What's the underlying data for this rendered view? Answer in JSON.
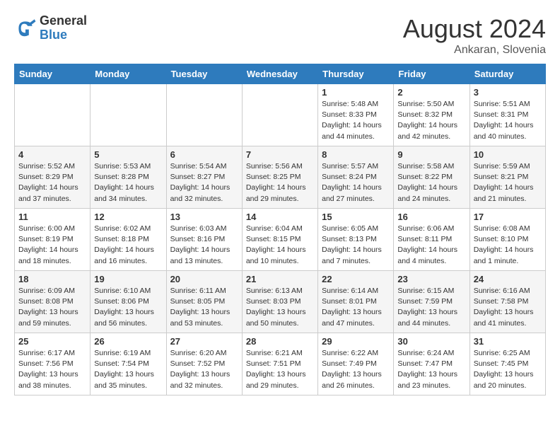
{
  "logo": {
    "general": "General",
    "blue": "Blue"
  },
  "header": {
    "month": "August 2024",
    "location": "Ankaran, Slovenia"
  },
  "days_of_week": [
    "Sunday",
    "Monday",
    "Tuesday",
    "Wednesday",
    "Thursday",
    "Friday",
    "Saturday"
  ],
  "weeks": [
    [
      {
        "day": "",
        "info": ""
      },
      {
        "day": "",
        "info": ""
      },
      {
        "day": "",
        "info": ""
      },
      {
        "day": "",
        "info": ""
      },
      {
        "day": "1",
        "info": "Sunrise: 5:48 AM\nSunset: 8:33 PM\nDaylight: 14 hours and 44 minutes."
      },
      {
        "day": "2",
        "info": "Sunrise: 5:50 AM\nSunset: 8:32 PM\nDaylight: 14 hours and 42 minutes."
      },
      {
        "day": "3",
        "info": "Sunrise: 5:51 AM\nSunset: 8:31 PM\nDaylight: 14 hours and 40 minutes."
      }
    ],
    [
      {
        "day": "4",
        "info": "Sunrise: 5:52 AM\nSunset: 8:29 PM\nDaylight: 14 hours and 37 minutes."
      },
      {
        "day": "5",
        "info": "Sunrise: 5:53 AM\nSunset: 8:28 PM\nDaylight: 14 hours and 34 minutes."
      },
      {
        "day": "6",
        "info": "Sunrise: 5:54 AM\nSunset: 8:27 PM\nDaylight: 14 hours and 32 minutes."
      },
      {
        "day": "7",
        "info": "Sunrise: 5:56 AM\nSunset: 8:25 PM\nDaylight: 14 hours and 29 minutes."
      },
      {
        "day": "8",
        "info": "Sunrise: 5:57 AM\nSunset: 8:24 PM\nDaylight: 14 hours and 27 minutes."
      },
      {
        "day": "9",
        "info": "Sunrise: 5:58 AM\nSunset: 8:22 PM\nDaylight: 14 hours and 24 minutes."
      },
      {
        "day": "10",
        "info": "Sunrise: 5:59 AM\nSunset: 8:21 PM\nDaylight: 14 hours and 21 minutes."
      }
    ],
    [
      {
        "day": "11",
        "info": "Sunrise: 6:00 AM\nSunset: 8:19 PM\nDaylight: 14 hours and 18 minutes."
      },
      {
        "day": "12",
        "info": "Sunrise: 6:02 AM\nSunset: 8:18 PM\nDaylight: 14 hours and 16 minutes."
      },
      {
        "day": "13",
        "info": "Sunrise: 6:03 AM\nSunset: 8:16 PM\nDaylight: 14 hours and 13 minutes."
      },
      {
        "day": "14",
        "info": "Sunrise: 6:04 AM\nSunset: 8:15 PM\nDaylight: 14 hours and 10 minutes."
      },
      {
        "day": "15",
        "info": "Sunrise: 6:05 AM\nSunset: 8:13 PM\nDaylight: 14 hours and 7 minutes."
      },
      {
        "day": "16",
        "info": "Sunrise: 6:06 AM\nSunset: 8:11 PM\nDaylight: 14 hours and 4 minutes."
      },
      {
        "day": "17",
        "info": "Sunrise: 6:08 AM\nSunset: 8:10 PM\nDaylight: 14 hours and 1 minute."
      }
    ],
    [
      {
        "day": "18",
        "info": "Sunrise: 6:09 AM\nSunset: 8:08 PM\nDaylight: 13 hours and 59 minutes."
      },
      {
        "day": "19",
        "info": "Sunrise: 6:10 AM\nSunset: 8:06 PM\nDaylight: 13 hours and 56 minutes."
      },
      {
        "day": "20",
        "info": "Sunrise: 6:11 AM\nSunset: 8:05 PM\nDaylight: 13 hours and 53 minutes."
      },
      {
        "day": "21",
        "info": "Sunrise: 6:13 AM\nSunset: 8:03 PM\nDaylight: 13 hours and 50 minutes."
      },
      {
        "day": "22",
        "info": "Sunrise: 6:14 AM\nSunset: 8:01 PM\nDaylight: 13 hours and 47 minutes."
      },
      {
        "day": "23",
        "info": "Sunrise: 6:15 AM\nSunset: 7:59 PM\nDaylight: 13 hours and 44 minutes."
      },
      {
        "day": "24",
        "info": "Sunrise: 6:16 AM\nSunset: 7:58 PM\nDaylight: 13 hours and 41 minutes."
      }
    ],
    [
      {
        "day": "25",
        "info": "Sunrise: 6:17 AM\nSunset: 7:56 PM\nDaylight: 13 hours and 38 minutes."
      },
      {
        "day": "26",
        "info": "Sunrise: 6:19 AM\nSunset: 7:54 PM\nDaylight: 13 hours and 35 minutes."
      },
      {
        "day": "27",
        "info": "Sunrise: 6:20 AM\nSunset: 7:52 PM\nDaylight: 13 hours and 32 minutes."
      },
      {
        "day": "28",
        "info": "Sunrise: 6:21 AM\nSunset: 7:51 PM\nDaylight: 13 hours and 29 minutes."
      },
      {
        "day": "29",
        "info": "Sunrise: 6:22 AM\nSunset: 7:49 PM\nDaylight: 13 hours and 26 minutes."
      },
      {
        "day": "30",
        "info": "Sunrise: 6:24 AM\nSunset: 7:47 PM\nDaylight: 13 hours and 23 minutes."
      },
      {
        "day": "31",
        "info": "Sunrise: 6:25 AM\nSunset: 7:45 PM\nDaylight: 13 hours and 20 minutes."
      }
    ]
  ]
}
